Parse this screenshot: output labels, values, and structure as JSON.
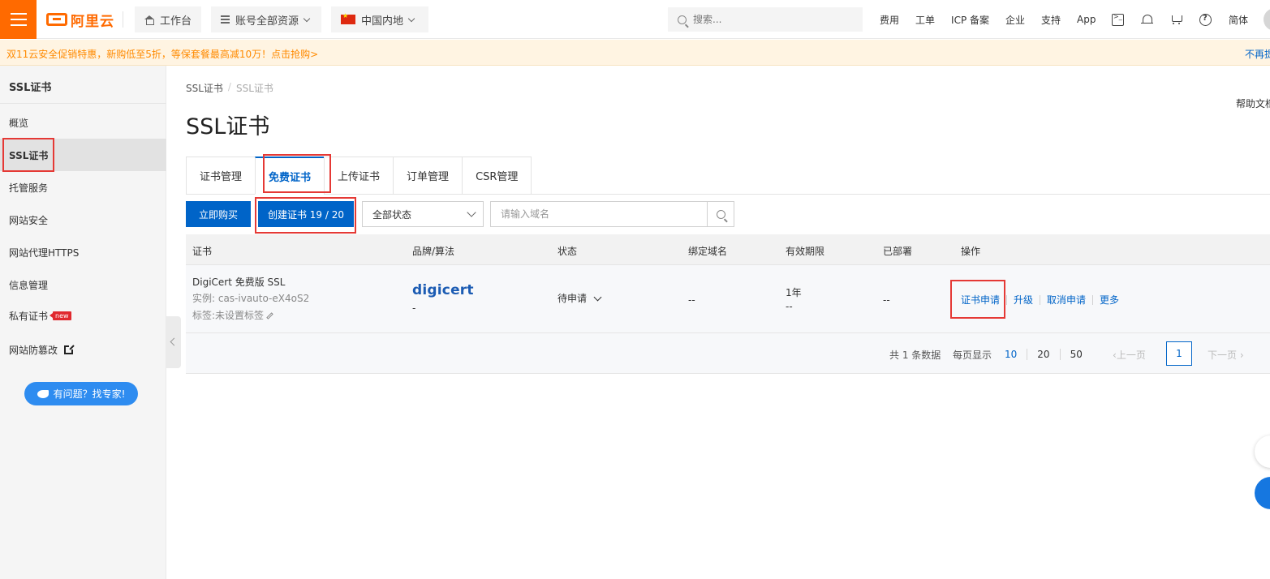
{
  "topbar": {
    "brand": "阿里云",
    "workbench": "工作台",
    "resources": "账号全部资源",
    "region": "中国内地",
    "search_placeholder": "搜索...",
    "links": [
      "费用",
      "工单",
      "ICP 备案",
      "企业",
      "支持",
      "App"
    ],
    "lang": "简体",
    "icons": [
      "terminal-icon",
      "bell-icon",
      "cart-icon",
      "help-icon"
    ]
  },
  "promo": {
    "text": "双11云安全促销特惠，新购低至5折，等保套餐最高减10万！点击抢购>",
    "close": "不再提示"
  },
  "sidebar": {
    "title": "SSL证书",
    "items": [
      "概览",
      "SSL证书",
      "托管服务",
      "网站安全",
      "网站代理HTTPS",
      "信息管理",
      "私有证书",
      "网站防篡改"
    ],
    "new_badge": "new",
    "expert": "有问题？找专家!"
  },
  "breadcrumb": [
    "SSL证书",
    "SSL证书"
  ],
  "page_title": "SSL证书",
  "help_doc": "帮助文档",
  "tabs": [
    "证书管理",
    "免费证书",
    "上传证书",
    "订单管理",
    "CSR管理"
  ],
  "toolbar": {
    "buy": "立即购买",
    "create": "创建证书 19 / 20",
    "status_filter": "全部状态",
    "domain_placeholder": "请输入域名"
  },
  "table": {
    "headers": [
      "证书",
      "品牌/算法",
      "状态",
      "绑定域名",
      "有效期限",
      "已部署",
      "操作"
    ],
    "row": {
      "name": "DigiCert 免费版 SSL",
      "instance": "实例: cas-ivauto-eX4oS2",
      "tag": "标签:未设置标签",
      "brand": "digicert",
      "algorithm": "-",
      "status": "待申请",
      "domain": "--",
      "validity": "1年",
      "validity_sub": "--",
      "deployed": "--",
      "ops": [
        "证书申请",
        "升级",
        "取消申请",
        "更多"
      ]
    }
  },
  "pagination": {
    "total": "共 1 条数据",
    "per_page_label": "每页显示",
    "sizes": [
      "10",
      "20",
      "50"
    ],
    "prev": "上一页",
    "next": "下一页",
    "current": "1"
  },
  "colors": {
    "accent": "#0064c8",
    "brand": "#ff6a00",
    "highlight": "#e53935"
  }
}
